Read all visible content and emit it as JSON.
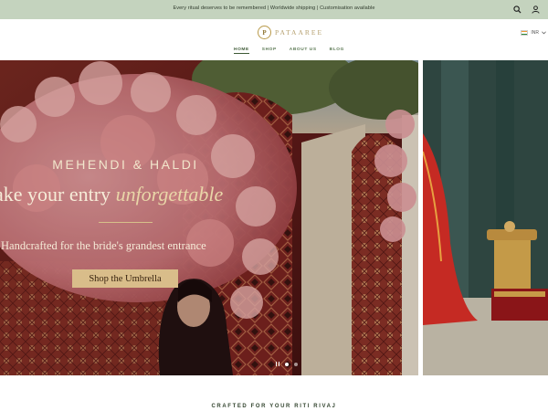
{
  "announcement": {
    "text": "Every ritual deserves to be remembered | Worldwide shipping | Customisation available"
  },
  "header": {
    "logo_mark": "P",
    "logo_text": "PATAAREE",
    "nav": [
      {
        "label": "HOME",
        "active": true
      },
      {
        "label": "SHOP",
        "active": false
      },
      {
        "label": "ABOUT US",
        "active": false
      },
      {
        "label": "BLOG",
        "active": false
      }
    ],
    "currency": "INR"
  },
  "hero": {
    "kicker": "MEHENDI & HALDI",
    "headline_plain": "ake your entry ",
    "headline_italic": "unforgettable",
    "subline": "Handcrafted for the bride's grandest entrance",
    "cta_label": "Shop the Umbrella",
    "slides_total": 2,
    "active_slide": 1
  },
  "section": {
    "title": "CRAFTED FOR YOUR RITI RIVAJ"
  },
  "colors": {
    "announcement_bg": "#c4d3be",
    "nav_text": "#5d7a55",
    "cta_bg": "#d9bd8a",
    "hero_text": "#f6ecd8"
  }
}
